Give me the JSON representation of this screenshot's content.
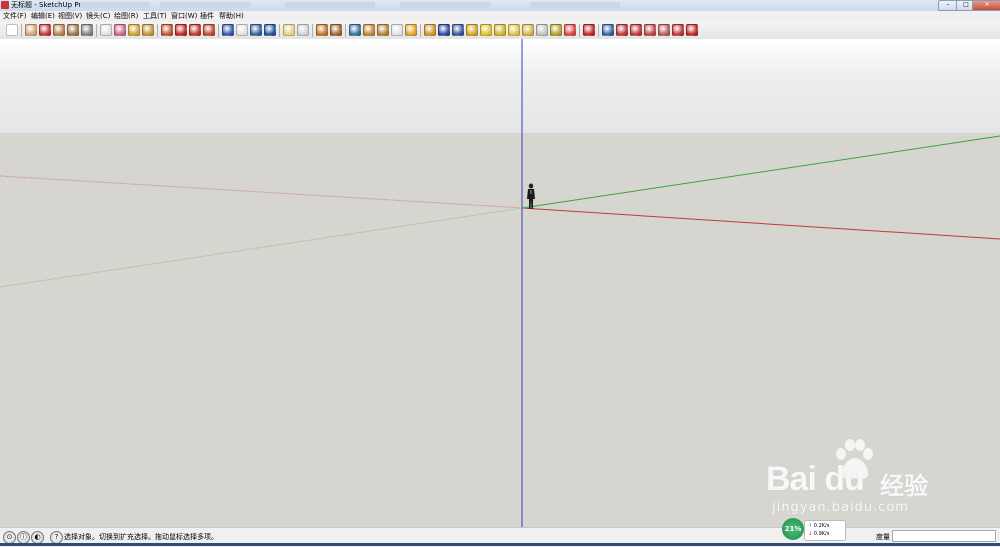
{
  "window": {
    "title": "无标题 - SketchUp Pro",
    "buttons": {
      "minimize": "–",
      "maximize": "□",
      "close": "✕"
    }
  },
  "menu": [
    {
      "label": "文件(F)"
    },
    {
      "label": "编辑(E)"
    },
    {
      "label": "视图(V)"
    },
    {
      "label": "镜头(C)"
    },
    {
      "label": "绘图(R)"
    },
    {
      "label": "工具(T)"
    },
    {
      "label": "窗口(W)"
    },
    {
      "label": "插件"
    },
    {
      "label": "帮助(H)"
    }
  ],
  "toolbar": {
    "tools": [
      {
        "name": "select-tool-icon",
        "color": "#ffffff"
      },
      {
        "name": "eraser-tool-icon",
        "color": "#d8a070"
      },
      {
        "name": "line-tool-icon",
        "color": "#c03030"
      },
      {
        "name": "rectangle-tool-icon",
        "color": "#b08050"
      },
      {
        "name": "circle-tool-icon",
        "color": "#a07040"
      },
      {
        "name": "arc-tool-icon",
        "color": "#808080"
      },
      {
        "name": "make-component-icon",
        "color": "#e0e0e0"
      },
      {
        "name": "paint-bucket-icon",
        "color": "#d06080"
      },
      {
        "name": "tape-measure-icon",
        "color": "#d0a030"
      },
      {
        "name": "protractor-icon",
        "color": "#c09030"
      },
      {
        "name": "push-pull-icon",
        "color": "#c05030"
      },
      {
        "name": "move-tool-icon",
        "color": "#c02020"
      },
      {
        "name": "rotate-tool-icon",
        "color": "#c03020"
      },
      {
        "name": "follow-me-icon",
        "color": "#c04030"
      },
      {
        "name": "orbit-tool-icon",
        "color": "#3050b0"
      },
      {
        "name": "pan-tool-icon",
        "color": "#e0e0e0"
      },
      {
        "name": "zoom-tool-icon",
        "color": "#3060a0"
      },
      {
        "name": "zoom-extents-icon",
        "color": "#2050a0"
      },
      {
        "name": "iso-view-icon",
        "color": "#e0d080"
      },
      {
        "name": "top-view-icon",
        "color": "#d0d0d0"
      },
      {
        "name": "walk-tool-icon",
        "color": "#c07020"
      },
      {
        "name": "look-around-icon",
        "color": "#a06020"
      },
      {
        "name": "position-camera-icon",
        "color": "#3070a0"
      },
      {
        "name": "component-icon",
        "color": "#c08030"
      },
      {
        "name": "material-icon",
        "color": "#b08030"
      },
      {
        "name": "style-icon",
        "color": "#e0e0e0"
      },
      {
        "name": "warehouse-icon",
        "color": "#e0a020"
      },
      {
        "name": "share-model-icon",
        "color": "#d09020"
      },
      {
        "name": "google-earth-icon",
        "color": "#3040a0"
      },
      {
        "name": "geo-location-icon",
        "color": "#3050a0"
      },
      {
        "name": "terrain-icon",
        "color": "#d0a020"
      },
      {
        "name": "sun-icon",
        "color": "#e0c020"
      },
      {
        "name": "shadow-icon",
        "color": "#d0b020"
      },
      {
        "name": "section-plane-icon",
        "color": "#e0c040"
      },
      {
        "name": "fog-icon",
        "color": "#d0b040"
      },
      {
        "name": "sphere-icon",
        "color": "#c0c0c0"
      },
      {
        "name": "solar-north-icon",
        "color": "#b0a020"
      },
      {
        "name": "color-wheel-icon",
        "color": "#e04040"
      },
      {
        "name": "su-extension-icon",
        "color": "#c02020"
      },
      {
        "name": "search-icon",
        "color": "#3060a0"
      },
      {
        "name": "previous-view-icon",
        "color": "#c03030"
      },
      {
        "name": "next-view-icon",
        "color": "#c03030"
      },
      {
        "name": "outer-shell-icon",
        "color": "#c04040"
      },
      {
        "name": "intersect-icon",
        "color": "#c05050"
      },
      {
        "name": "union-icon",
        "color": "#c03030"
      },
      {
        "name": "ruby-console-icon",
        "color": "#c02020"
      }
    ]
  },
  "scene": {
    "sky_color": "#ffffff",
    "ground_color": "#d6d5d0",
    "axis_colors": {
      "red": "#c0393b",
      "green": "#3ca33c",
      "blue": "#3a3ac0"
    }
  },
  "status": {
    "icons": [
      "geo-location-status-icon",
      "credits-status-icon",
      "info-status-icon",
      "help-status-icon"
    ],
    "message": "选择对象。切换到扩充选择。拖动鼠标选择多项。",
    "measurement_label": "度量",
    "measurement_value": ""
  },
  "network_widget": {
    "percent": "21%",
    "upload_arrow": "↑",
    "download_arrow": "↓",
    "upload": "0.2K/s",
    "download": "0.9K/s"
  },
  "watermark": {
    "brand": "Bai du",
    "cn": "经验",
    "url": "jingyan.baidu.com"
  }
}
